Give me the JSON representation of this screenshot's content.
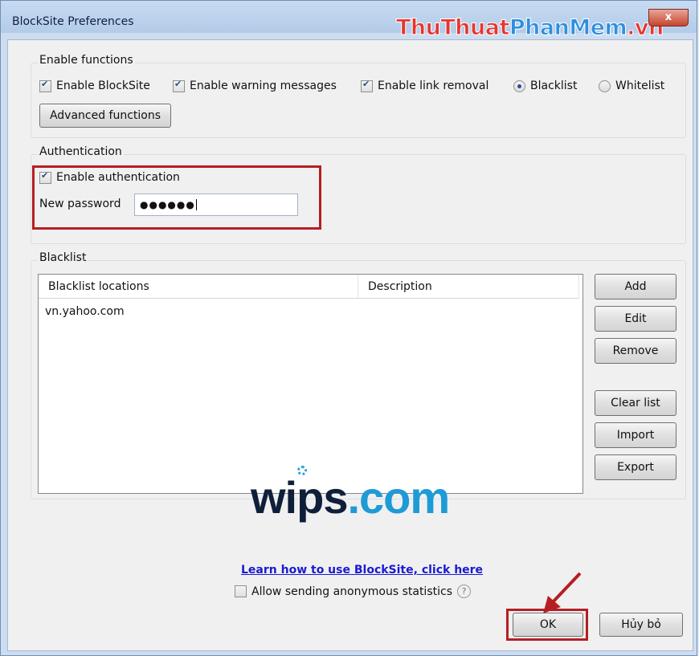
{
  "window": {
    "title": "BlockSite Preferences",
    "close_glyph": "x"
  },
  "watermark": {
    "part1": "Thu",
    "part2": "Thuat",
    "part3": "PhanMem",
    "part4": ".vn"
  },
  "enable_functions": {
    "group_label": "Enable functions",
    "enable_blocksite": {
      "label": "Enable BlockSite",
      "checked": true
    },
    "enable_warning": {
      "label": "Enable warning messages",
      "checked": true
    },
    "enable_link_removal": {
      "label": "Enable link removal",
      "checked": true
    },
    "blacklist_radio": {
      "label": "Blacklist",
      "selected": true
    },
    "whitelist_radio": {
      "label": "Whitelist",
      "selected": false
    },
    "advanced_button": "Advanced functions"
  },
  "authentication": {
    "group_label": "Authentication",
    "enable_auth": {
      "label": "Enable authentication",
      "checked": true
    },
    "password_label": "New password",
    "password_value": "●●●●●●"
  },
  "blacklist": {
    "group_label": "Blacklist",
    "columns": [
      "Blacklist locations",
      "Description"
    ],
    "rows": [
      {
        "location": "vn.yahoo.com",
        "description": ""
      }
    ],
    "buttons": {
      "add": "Add",
      "edit": "Edit",
      "remove": "Remove",
      "clear": "Clear list",
      "import": "Import",
      "export": "Export"
    }
  },
  "footer": {
    "logo_dark": "wips",
    "logo_blue": ".com",
    "learn_link": "Learn how to use BlockSite, click here",
    "stats": {
      "label": "Allow sending anonymous statistics",
      "checked": false
    },
    "help_glyph": "?",
    "ok_button": "OK",
    "cancel_button": "Hủy bỏ"
  },
  "colors": {
    "highlight_red": "#b51f23",
    "link_blue": "#1a1ad2",
    "wips_blue": "#1e9bd6"
  }
}
